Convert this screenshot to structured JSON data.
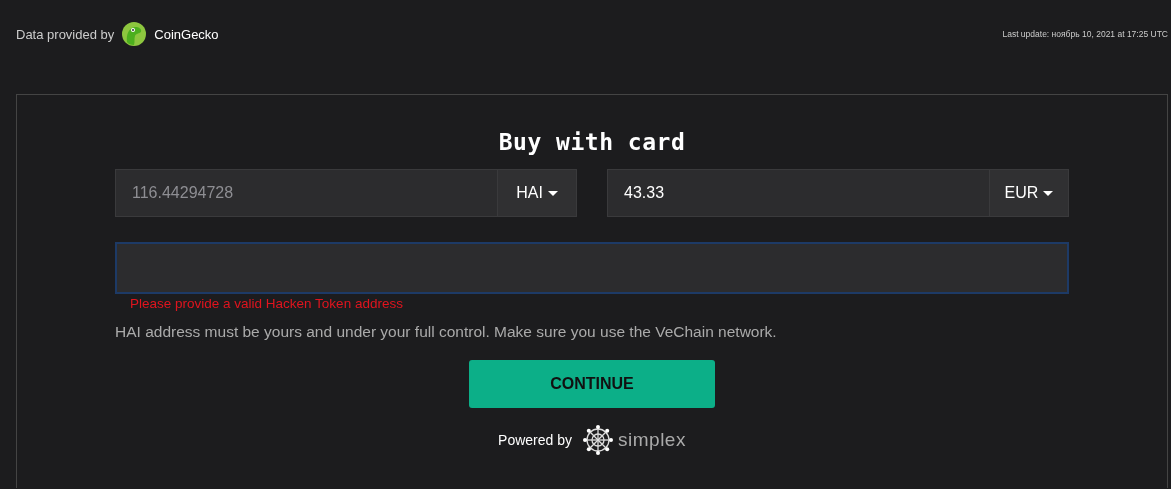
{
  "header": {
    "provider_label": "Data provided by",
    "provider_name": "CoinGecko",
    "last_update": "Last update: ноябрь 10, 2021 at 17:25 UTC"
  },
  "form": {
    "title": "Buy with card",
    "amounts": [
      {
        "value": "116.44294728",
        "muted": true,
        "currency": "HAI"
      },
      {
        "value": "43.33",
        "muted": false,
        "currency": "EUR"
      }
    ],
    "address_field": {
      "focused": true,
      "error": "Please provide a valid Hacken Token address"
    },
    "note": "HAI address must be yours and under your full control. Make sure you use the VeChain network.",
    "button": "CONTINUE",
    "powered_by": "Powered by",
    "powered_brand": "simplex"
  }
}
